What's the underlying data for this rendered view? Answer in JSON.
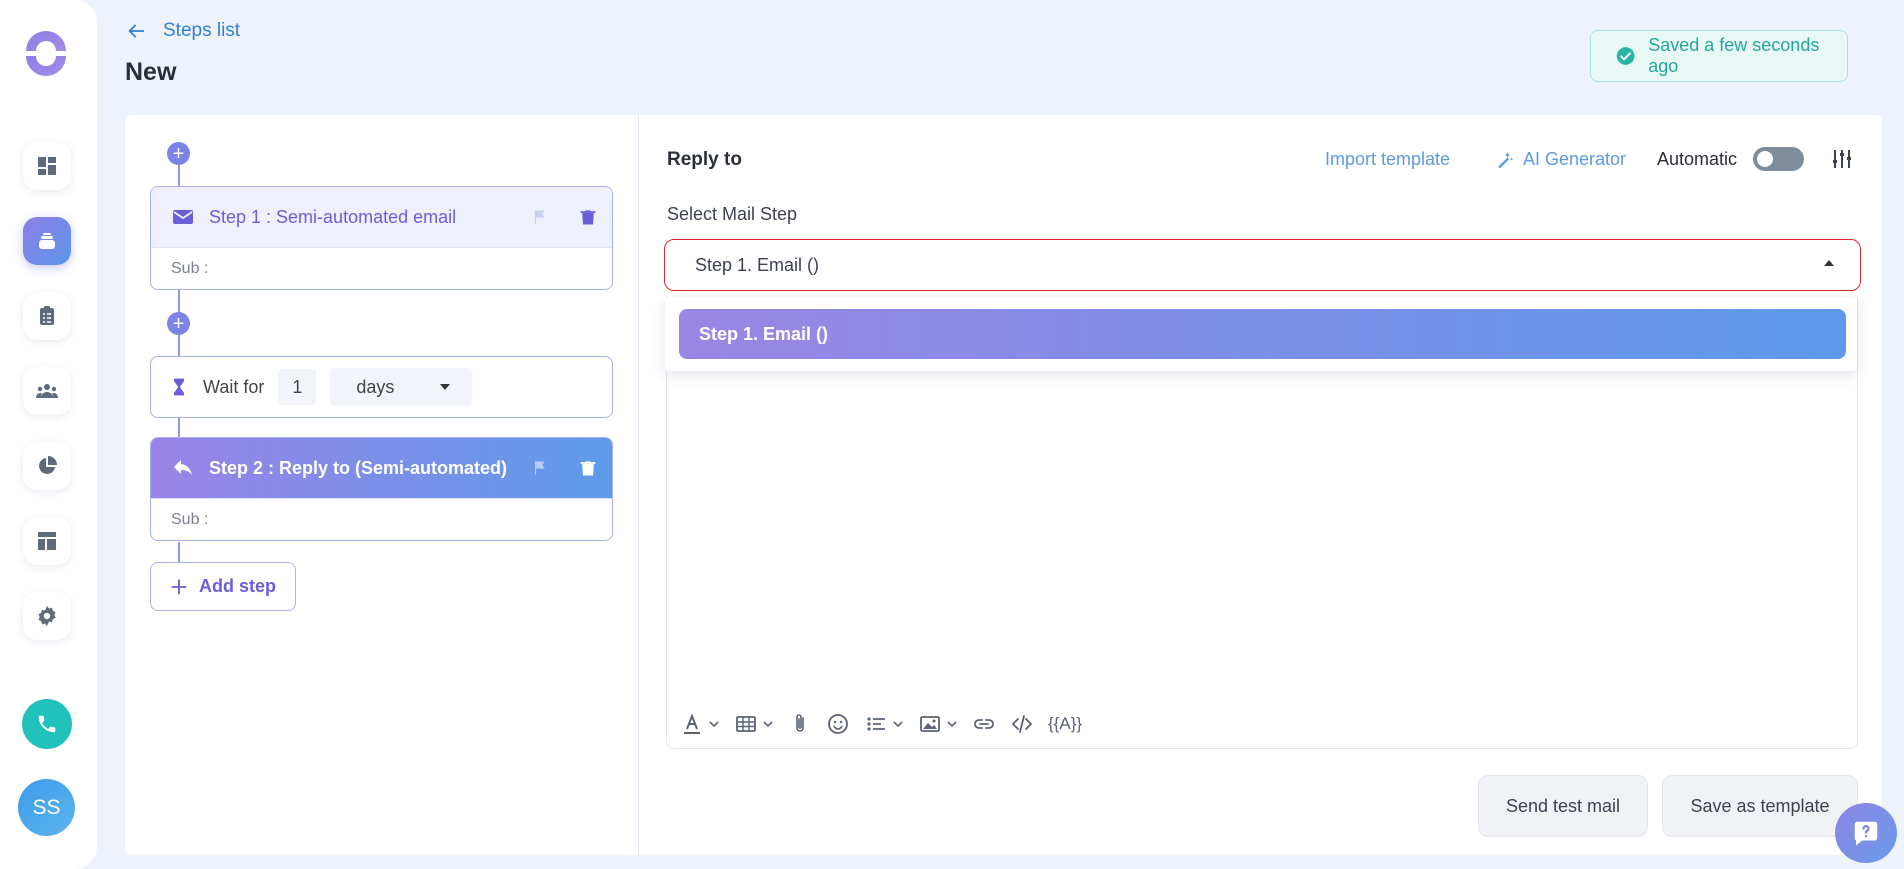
{
  "header": {
    "back_label": "Steps list",
    "title": "New",
    "saved_status": "Saved a few seconds ago"
  },
  "sidebar": {
    "items": [
      {
        "icon": "dashboard-icon"
      },
      {
        "icon": "campaigns-icon",
        "active": true
      },
      {
        "icon": "clipboard-icon"
      },
      {
        "icon": "team-icon"
      },
      {
        "icon": "pie-chart-icon"
      },
      {
        "icon": "layout-icon"
      },
      {
        "icon": "gear-icon"
      }
    ],
    "phone_icon": "phone-icon",
    "avatar_initials": "SS"
  },
  "steps": {
    "step1": {
      "title": "Step 1 : Semi-automated email",
      "sub_label": "Sub :"
    },
    "wait": {
      "label": "Wait for",
      "value": "1",
      "unit": "days"
    },
    "step2": {
      "title": "Step 2 : Reply to (Semi-automated)",
      "sub_label": "Sub :"
    },
    "add_step_label": "Add step"
  },
  "editor": {
    "title": "Reply to",
    "import_template_label": "Import template",
    "ai_generator_label": "AI Generator",
    "automatic_label": "Automatic",
    "automatic_on": false,
    "select_label": "Select Mail Step",
    "select_value": "Step 1. Email ()",
    "dropdown_options": [
      "Step 1. Email ()"
    ],
    "variables_label": "{{A}}",
    "send_test_mail_label": "Send test mail",
    "save_as_template_label": "Save as template"
  },
  "colors": {
    "accent_purple": "#9a86e4",
    "accent_blue": "#5d99e9",
    "success": "#26a69a",
    "error_border": "#e0262f"
  }
}
